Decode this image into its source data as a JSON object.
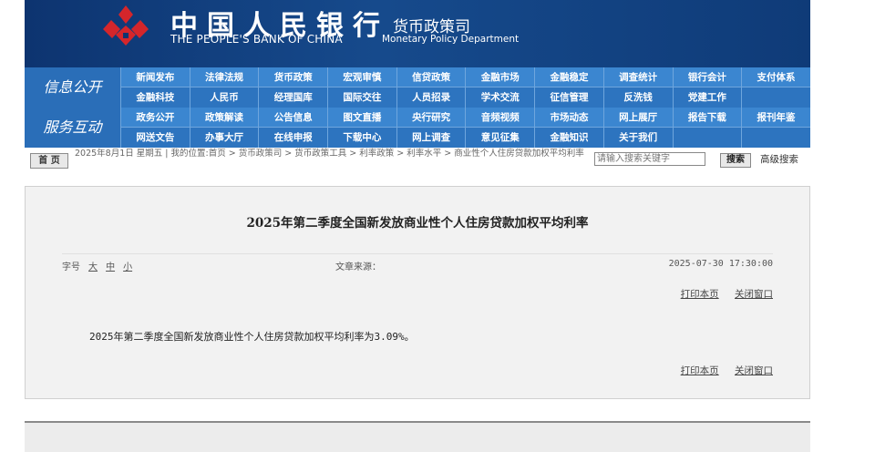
{
  "header": {
    "bank_name_cn": "中国人民银行",
    "bank_name_en": "THE PEOPLE'S BANK OF CHINA",
    "department_cn": "货币政策司",
    "department_en": "Monetary Policy Department",
    "logo_color": "#d4262b"
  },
  "nav": {
    "group1_title": "信息公开",
    "group1_items": [
      "新闻发布",
      "法律法规",
      "货币政策",
      "宏观审慎",
      "信贷政策",
      "金融市场",
      "金融稳定",
      "调查统计",
      "银行会计",
      "支付体系",
      "金融科技",
      "人民币",
      "经理国库",
      "国际交往",
      "人员招录",
      "学术交流",
      "征信管理",
      "反洗钱",
      "党建工作",
      ""
    ],
    "group2_title": "服务互动",
    "group2_items": [
      "政务公开",
      "政策解读",
      "公告信息",
      "图文直播",
      "央行研究",
      "音频视频",
      "市场动态",
      "网上展厅",
      "报告下载",
      "报刊年鉴",
      "网送文告",
      "办事大厅",
      "在线申报",
      "下载中心",
      "网上调查",
      "意见征集",
      "金融知识",
      "关于我们",
      "",
      ""
    ]
  },
  "breadcrumb": {
    "home_label": "首 页",
    "text": "2025年8月1日 星期五 | 我的位置:首页 > 货币政策司 > 货币政策工具 > 利率政策 > 利率水平 > 商业性个人住房贷款加权平均利率"
  },
  "search": {
    "placeholder": "请输入搜索关键字",
    "button_label": "搜索",
    "advanced_label": "高级搜索"
  },
  "article": {
    "title": "2025年第二季度全国新发放商业性个人住房贷款加权平均利率",
    "font_size_label": "字号",
    "font_large": "大",
    "font_medium": "中",
    "font_small": "小",
    "source_label": "文章来源：",
    "date": "2025-07-30 17:30:00",
    "print_label": "打印本页",
    "close_label": "关闭窗口",
    "body": "2025年第二季度全国新发放商业性个人住房贷款加权平均利率为3.09%。"
  }
}
